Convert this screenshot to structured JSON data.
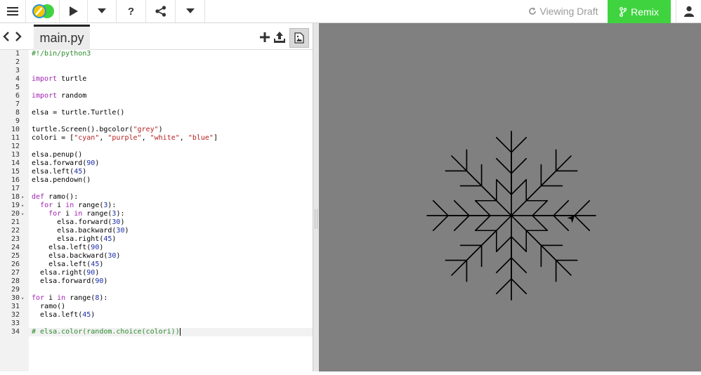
{
  "toolbar": {
    "menu_icon": "hamburger-icon",
    "logo_icon": "trinket-logo-icon",
    "run_icon": "play-icon",
    "run_options_icon": "chevron-down-icon",
    "help_label": "?",
    "share_icon": "share-icon",
    "more_icon": "chevron-down-icon",
    "viewing_label": "Viewing Draft",
    "remix_label": "Remix",
    "user_icon": "user-icon"
  },
  "editor": {
    "file_tab": "main.py",
    "add_file_icon": "plus-icon",
    "upload_icon": "upload-icon",
    "image_icon": "image-icon",
    "active_line": 34,
    "lines": [
      {
        "n": "1",
        "fold": "",
        "text": "#!/bin/python3"
      },
      {
        "n": "2",
        "fold": "",
        "text": ""
      },
      {
        "n": "3",
        "fold": "",
        "text": ""
      },
      {
        "n": "4",
        "fold": "",
        "text": "import turtle"
      },
      {
        "n": "5",
        "fold": "",
        "text": ""
      },
      {
        "n": "6",
        "fold": "",
        "text": "import random"
      },
      {
        "n": "7",
        "fold": "",
        "text": ""
      },
      {
        "n": "8",
        "fold": "",
        "text": "elsa = turtle.Turtle()"
      },
      {
        "n": "9",
        "fold": "",
        "text": ""
      },
      {
        "n": "10",
        "fold": "",
        "text": "turtle.Screen().bgcolor(\"grey\")"
      },
      {
        "n": "11",
        "fold": "",
        "text": "colori = [\"cyan\", \"purple\", \"white\", \"blue\"]"
      },
      {
        "n": "12",
        "fold": "",
        "text": ""
      },
      {
        "n": "13",
        "fold": "",
        "text": "elsa.penup()"
      },
      {
        "n": "14",
        "fold": "",
        "text": "elsa.forward(90)"
      },
      {
        "n": "15",
        "fold": "",
        "text": "elsa.left(45)"
      },
      {
        "n": "16",
        "fold": "",
        "text": "elsa.pendown()"
      },
      {
        "n": "17",
        "fold": "",
        "text": ""
      },
      {
        "n": "18",
        "fold": "▾",
        "text": "def ramo():"
      },
      {
        "n": "19",
        "fold": "▾",
        "text": "  for i in range(3):"
      },
      {
        "n": "20",
        "fold": "▾",
        "text": "    for i in range(3):"
      },
      {
        "n": "21",
        "fold": "",
        "text": "      elsa.forward(30)"
      },
      {
        "n": "22",
        "fold": "",
        "text": "      elsa.backward(30)"
      },
      {
        "n": "23",
        "fold": "",
        "text": "      elsa.right(45)"
      },
      {
        "n": "24",
        "fold": "",
        "text": "    elsa.left(90)"
      },
      {
        "n": "25",
        "fold": "",
        "text": "    elsa.backward(30)"
      },
      {
        "n": "26",
        "fold": "",
        "text": "    elsa.left(45)"
      },
      {
        "n": "27",
        "fold": "",
        "text": "  elsa.right(90)"
      },
      {
        "n": "28",
        "fold": "",
        "text": "  elsa.forward(90)"
      },
      {
        "n": "29",
        "fold": "",
        "text": ""
      },
      {
        "n": "30",
        "fold": "▾",
        "text": "for i in range(8):"
      },
      {
        "n": "31",
        "fold": "",
        "text": "  ramo()"
      },
      {
        "n": "32",
        "fold": "",
        "text": "  elsa.left(45)"
      },
      {
        "n": "33",
        "fold": "",
        "text": ""
      },
      {
        "n": "34",
        "fold": "",
        "text": "# elsa.color(random.choice(colori))"
      }
    ]
  },
  "output": {
    "background": "#808080",
    "stroke": "#000000",
    "turtle_icon": "turtle-arrow-icon"
  }
}
